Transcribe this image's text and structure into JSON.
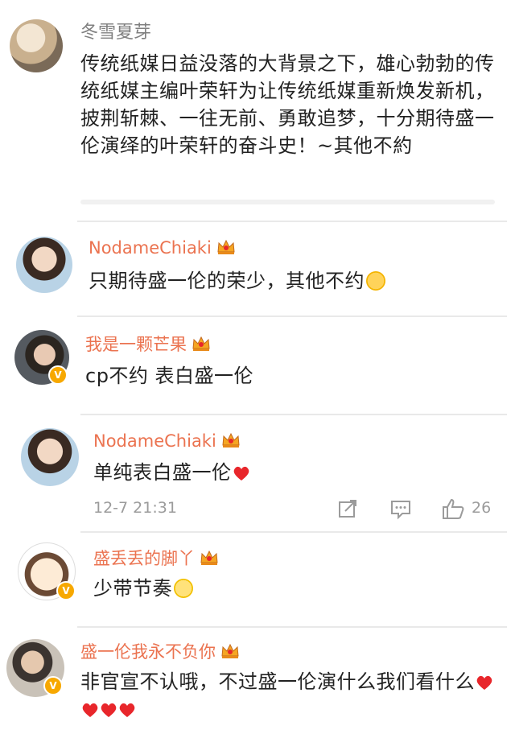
{
  "comments": [
    {
      "name": "冬雪夏芽",
      "text": "传统纸媒日益没落的大背景之下，雄心勃勃的传统纸媒主编叶荣轩为让传统纸媒重新焕发新机，披荆斩棘、一往无前、勇敢追梦，十分期待盛一伦演绎的叶荣轩的奋斗史！~其他不約"
    },
    {
      "name": "NodameChiaki",
      "text": "只期待盛一伦的荣少，其他不约"
    },
    {
      "name": "我是一颗芒果",
      "text": "cp不约 表白盛一伦"
    },
    {
      "name": "NodameChiaki",
      "text": "单纯表白盛一伦",
      "time": "12-7 21:31",
      "likes": "26"
    },
    {
      "name": "盛丢丢的脚丫",
      "text": "少带节奏"
    },
    {
      "name": "盛一伦我永不负你",
      "text": "非官宣不认哦，不过盛一伦演什么我们看什么"
    }
  ],
  "colors": {
    "username": "#eb7350",
    "text": "#222222",
    "meta": "#9b9b9b",
    "heart": "#e8262b",
    "vbadge": "#f7a800"
  },
  "icons": {
    "crown": "crown-member-icon",
    "verified": "verified-v-icon",
    "share": "share-icon",
    "comment": "comment-icon",
    "like": "thumbs-up-icon",
    "heart": "heart-icon",
    "blush": "blush-face-emoji",
    "smile": "smile-face-emoji"
  }
}
